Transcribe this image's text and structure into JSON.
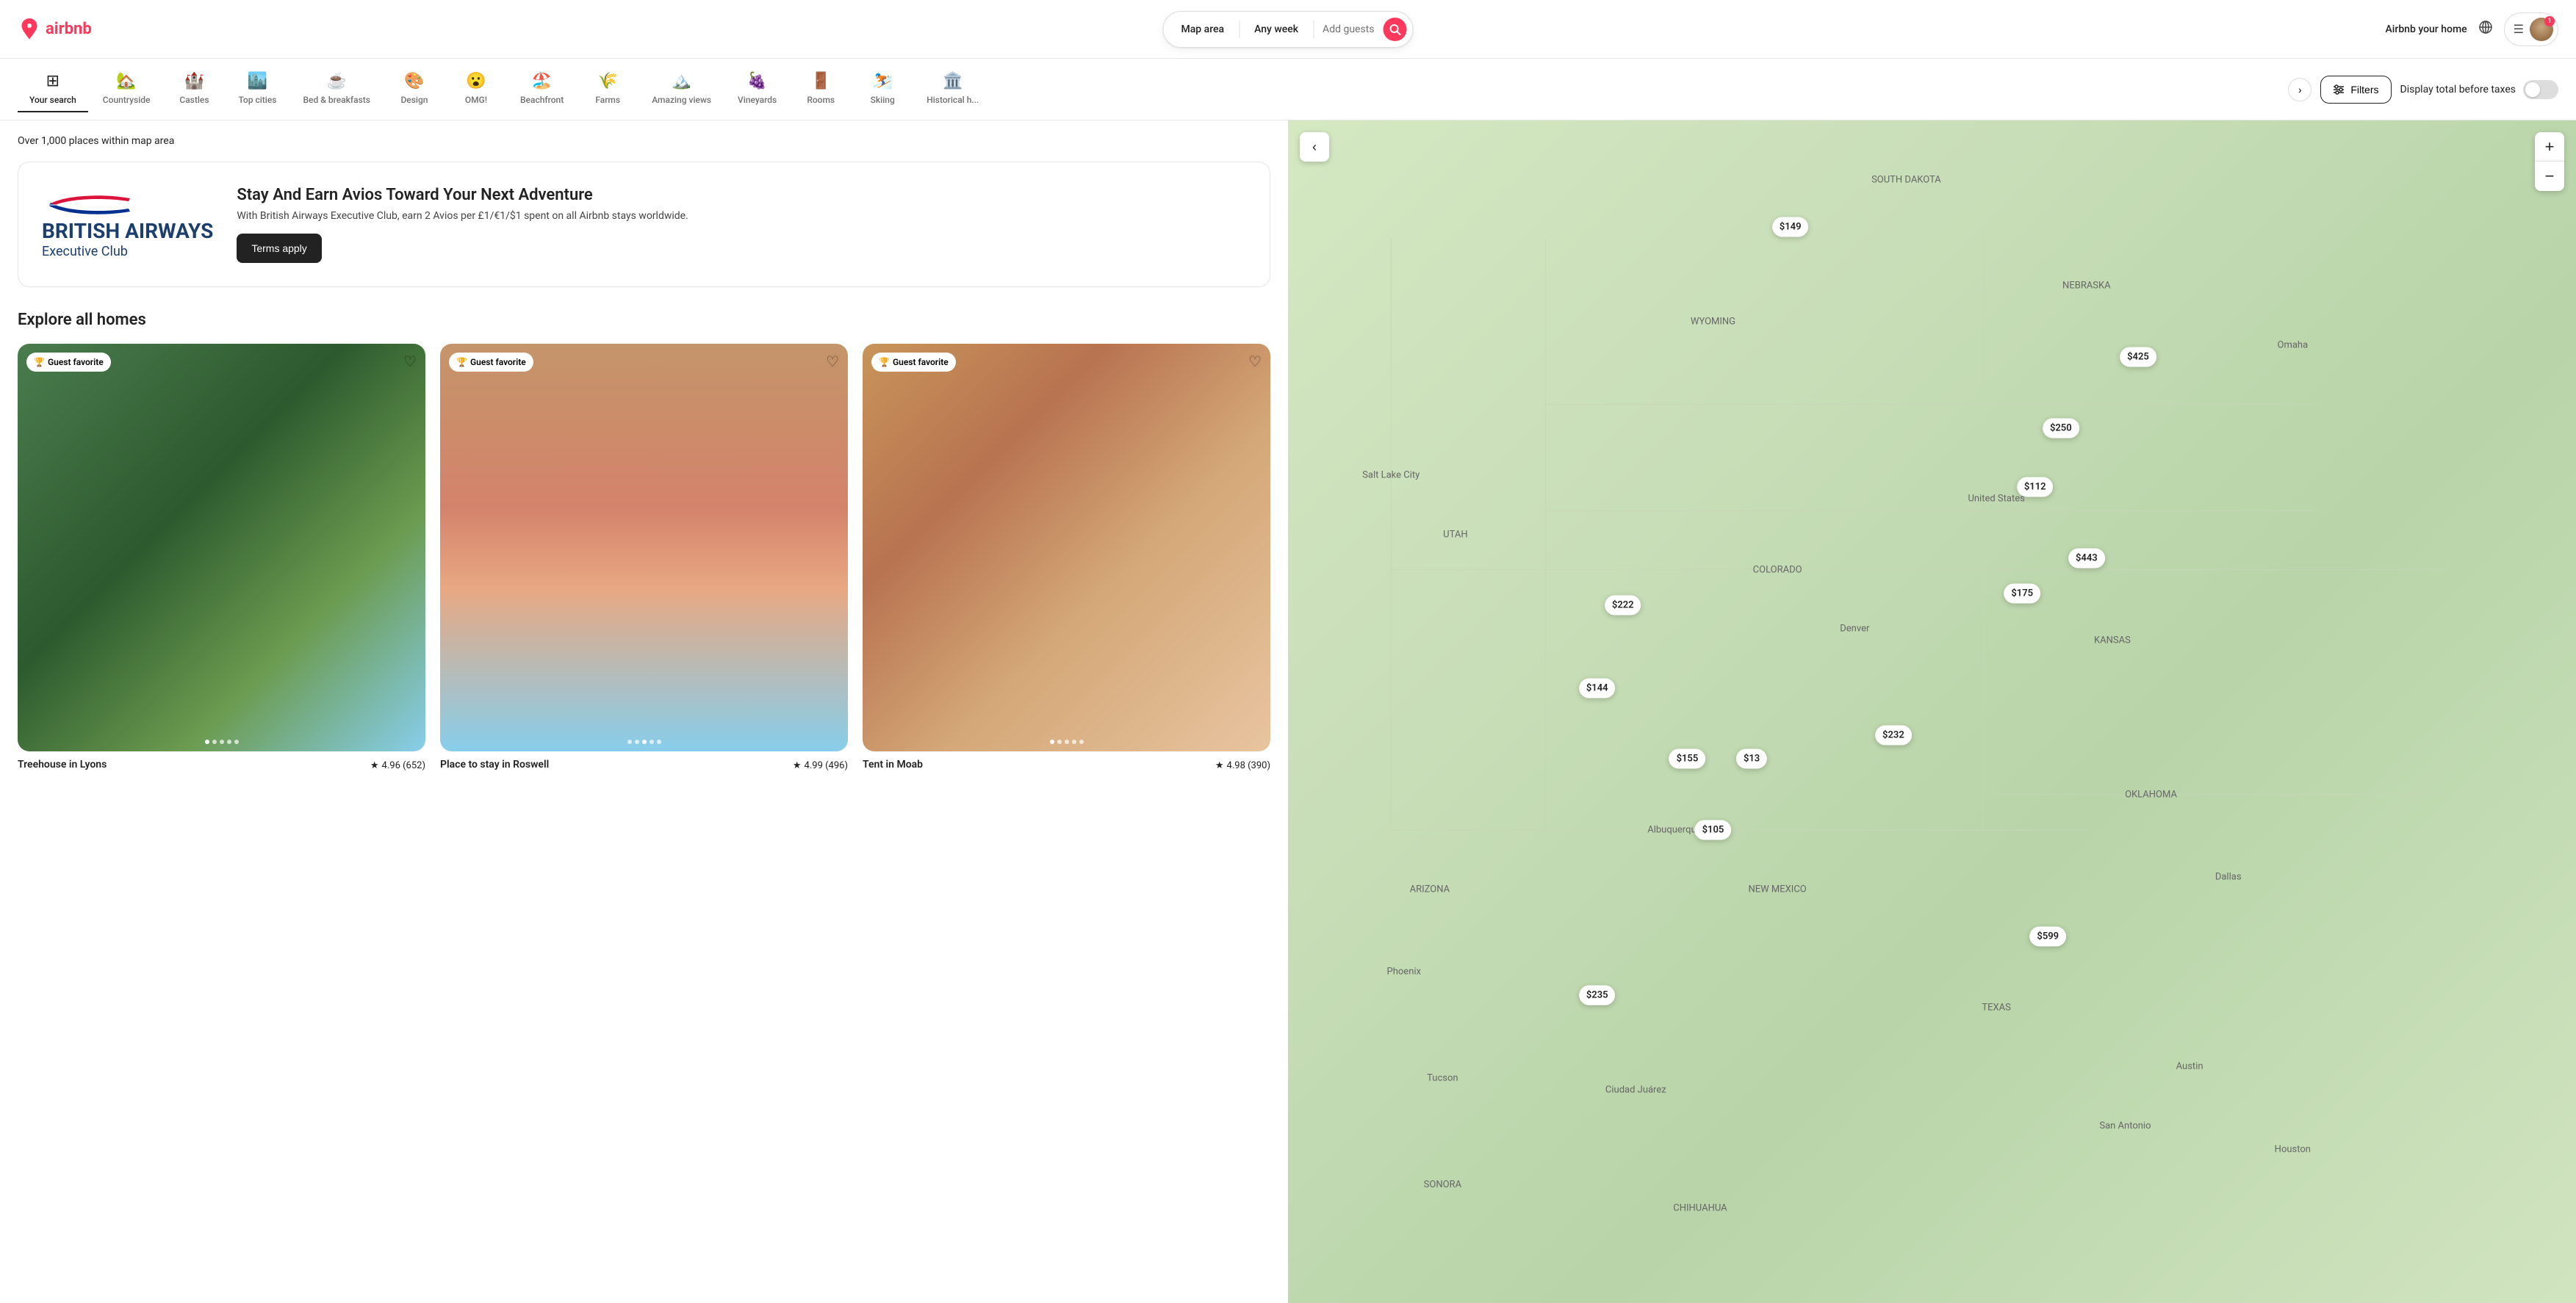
{
  "header": {
    "logo_text": "airbnb",
    "search": {
      "location": "Map area",
      "dates": "Any week",
      "guests": "Add guests"
    },
    "nav_right": {
      "airbnb_home": "Airbnb your home",
      "notification_count": "1"
    }
  },
  "categories": [
    {
      "id": "your-search",
      "icon": "⊞",
      "label": "Your search",
      "active": true
    },
    {
      "id": "countryside",
      "icon": "🏡",
      "label": "Countryside",
      "active": false
    },
    {
      "id": "castles",
      "icon": "🏰",
      "label": "Castles",
      "active": false
    },
    {
      "id": "top-cities",
      "icon": "🏙️",
      "label": "Top cities",
      "active": false
    },
    {
      "id": "bed-breakfasts",
      "icon": "☕",
      "label": "Bed & breakfasts",
      "active": false
    },
    {
      "id": "design",
      "icon": "🎨",
      "label": "Design",
      "active": false
    },
    {
      "id": "omg",
      "icon": "😮",
      "label": "OMG!",
      "active": false
    },
    {
      "id": "beachfront",
      "icon": "🏖️",
      "label": "Beachfront",
      "active": false
    },
    {
      "id": "farms",
      "icon": "🌾",
      "label": "Farms",
      "active": false
    },
    {
      "id": "amazing-views",
      "icon": "🏔️",
      "label": "Amazing views",
      "active": false
    },
    {
      "id": "vineyards",
      "icon": "🍇",
      "label": "Vineyards",
      "active": false
    },
    {
      "id": "rooms",
      "icon": "🚪",
      "label": "Rooms",
      "active": false
    },
    {
      "id": "skiing",
      "icon": "⛷️",
      "label": "Skiing",
      "active": false
    },
    {
      "id": "historical",
      "icon": "🏛️",
      "label": "Historical h...",
      "active": false
    }
  ],
  "filters": {
    "label": "Filters",
    "display_total_label": "Display total before taxes"
  },
  "results": {
    "count_text": "Over 1,000 places within map area"
  },
  "promo": {
    "brand_name": "BRITISH AIRWAYS",
    "brand_sub": "Executive Club",
    "title": "Stay And Earn Avios Toward Your Next Adventure",
    "description": "With British Airways Executive Club, earn 2 Avios per £1/€1/$1 spent on all Airbnb stays worldwide.",
    "cta": "Terms apply"
  },
  "explore": {
    "title": "Explore all homes",
    "listings": [
      {
        "id": "listing-1",
        "name": "Treehouse in Lyons",
        "badge": "Guest favorite",
        "rating": "4.96",
        "reviews": "652",
        "dots": 5,
        "active_dot": 0,
        "img_class": "img-treehouse"
      },
      {
        "id": "listing-2",
        "name": "Place to stay in Roswell",
        "badge": "Guest favorite",
        "rating": "4.99",
        "reviews": "496",
        "dots": 5,
        "active_dot": 2,
        "img_class": "img-roswell"
      },
      {
        "id": "listing-3",
        "name": "Tent in Moab",
        "badge": "Guest favorite",
        "rating": "4.98",
        "reviews": "390",
        "dots": 5,
        "active_dot": 0,
        "img_class": "img-moab"
      }
    ]
  },
  "map": {
    "collapse_icon": "‹",
    "zoom_in": "+",
    "zoom_out": "−",
    "price_pins": [
      {
        "id": "pin-149",
        "label": "$149",
        "x": "39%",
        "y": "9%"
      },
      {
        "id": "pin-425",
        "label": "$425",
        "x": "66%",
        "y": "20%"
      },
      {
        "id": "pin-250",
        "label": "$250",
        "x": "60%",
        "y": "26%"
      },
      {
        "id": "pin-112",
        "label": "$112",
        "x": "58%",
        "y": "31%"
      },
      {
        "id": "pin-443",
        "label": "$443",
        "x": "62%",
        "y": "37%"
      },
      {
        "id": "pin-175",
        "label": "$175",
        "x": "57%",
        "y": "40%"
      },
      {
        "id": "pin-222",
        "label": "$222",
        "x": "26%",
        "y": "41%"
      },
      {
        "id": "pin-144",
        "label": "$144",
        "x": "24%",
        "y": "48%"
      },
      {
        "id": "pin-155",
        "label": "$155",
        "x": "31%",
        "y": "54%"
      },
      {
        "id": "pin-13",
        "label": "$13",
        "x": "36%",
        "y": "54%"
      },
      {
        "id": "pin-232",
        "label": "$232",
        "x": "47%",
        "y": "52%"
      },
      {
        "id": "pin-105",
        "label": "$105",
        "x": "33%",
        "y": "60%"
      },
      {
        "id": "pin-235",
        "label": "$235",
        "x": "24%",
        "y": "74%"
      },
      {
        "id": "pin-599",
        "label": "$599",
        "x": "59%",
        "y": "69%"
      }
    ],
    "state_labels": [
      {
        "label": "SOUTH DAKOTA",
        "x": "48%",
        "y": "5%"
      },
      {
        "label": "WYOMING",
        "x": "33%",
        "y": "17%"
      },
      {
        "label": "NEBRASKA",
        "x": "62%",
        "y": "14%"
      },
      {
        "label": "Omaha",
        "x": "78%",
        "y": "19%"
      },
      {
        "label": "UTAH",
        "x": "13%",
        "y": "35%"
      },
      {
        "label": "KANSAS",
        "x": "64%",
        "y": "44%"
      },
      {
        "label": "COLORADO",
        "x": "38%",
        "y": "38%"
      },
      {
        "label": "United States",
        "x": "55%",
        "y": "32%"
      },
      {
        "label": "Salt Lake City",
        "x": "8%",
        "y": "30%"
      },
      {
        "label": "Denver",
        "x": "44%",
        "y": "43%"
      },
      {
        "label": "ARIZONA",
        "x": "11%",
        "y": "65%"
      },
      {
        "label": "NEW MEXICO",
        "x": "38%",
        "y": "65%"
      },
      {
        "label": "OKLAHOMA",
        "x": "67%",
        "y": "57%"
      },
      {
        "label": "Albuquerque",
        "x": "30%",
        "y": "60%"
      },
      {
        "label": "Phoenix",
        "x": "9%",
        "y": "72%"
      },
      {
        "label": "Tucson",
        "x": "12%",
        "y": "81%"
      },
      {
        "label": "Ciudad Juárez",
        "x": "27%",
        "y": "82%"
      },
      {
        "label": "SONORA",
        "x": "12%",
        "y": "90%"
      },
      {
        "label": "CHIHUAHUA",
        "x": "32%",
        "y": "92%"
      },
      {
        "label": "TEXAS",
        "x": "55%",
        "y": "75%"
      },
      {
        "label": "Dallas",
        "x": "73%",
        "y": "64%"
      },
      {
        "label": "Austin",
        "x": "70%",
        "y": "80%"
      },
      {
        "label": "Houston",
        "x": "78%",
        "y": "87%"
      },
      {
        "label": "San Antonio",
        "x": "65%",
        "y": "85%"
      }
    ]
  }
}
